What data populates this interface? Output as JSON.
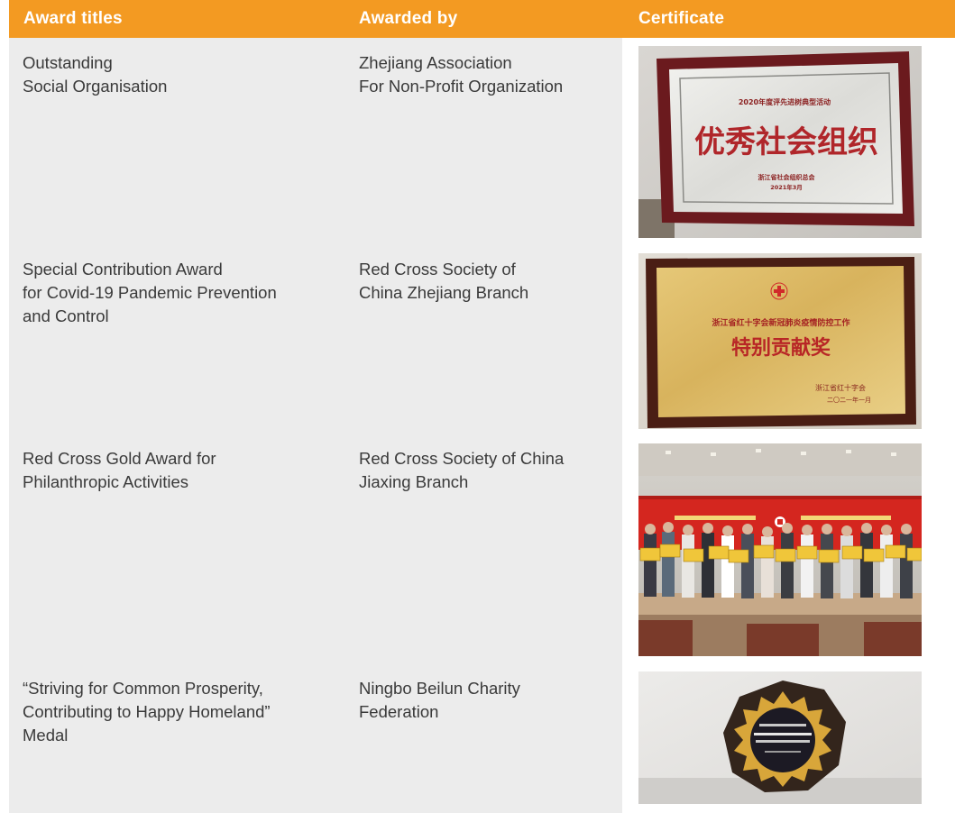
{
  "header": {
    "award_titles": "Award titles",
    "awarded_by": "Awarded by",
    "certificate": "Certificate"
  },
  "awards": [
    {
      "title": "Outstanding\nSocial Organisation",
      "awarded_by": "Zhejiang Association\nFor Non-Profit Organization",
      "certificate": {
        "line1": "2020年度评先进树典型活动",
        "main": "优秀社会组织",
        "issuer": "浙江省社会组织总会",
        "date": "2021年3月"
      }
    },
    {
      "title": "Special Contribution Award\nfor Covid-19 Pandemic Prevention\nand Control",
      "awarded_by": "Red Cross Society of\nChina Zhejiang Branch",
      "certificate": {
        "line1": "浙江省红十字会新冠肺炎疫情防控工作",
        "main": "特别贡献奖",
        "issuer": "浙江省红十字会",
        "date": "二〇二一年一月"
      }
    },
    {
      "title": "Red Cross Gold Award for\nPhilanthropic Activities",
      "awarded_by": "Red Cross Society of China\nJiaxing Branch"
    },
    {
      "title": "“Striving for Common Prosperity,\nContributing to Happy Homeland”\nMedal",
      "awarded_by": "Ningbo Beilun Charity\nFederation"
    }
  ],
  "colors": {
    "header": "#f39a22",
    "panel": "#ececec",
    "text": "#3a3a3a"
  }
}
